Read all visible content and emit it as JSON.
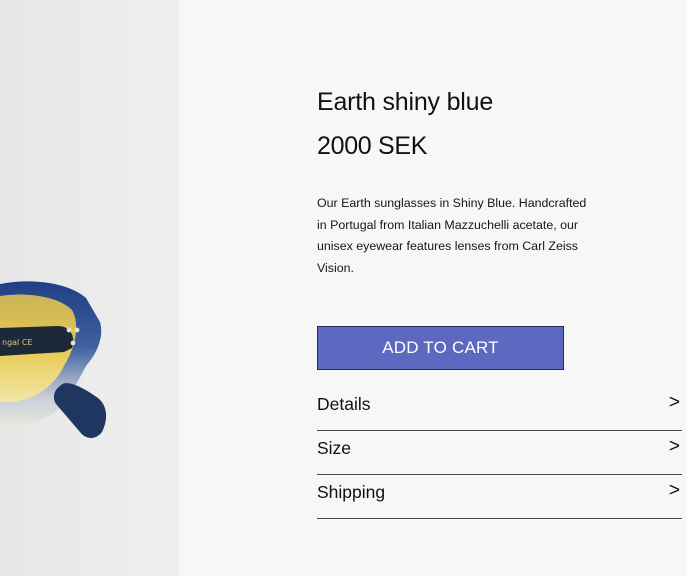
{
  "product": {
    "title": "Earth shiny blue",
    "price": "2000 SEK",
    "description": "Our Earth sunglasses in Shiny Blue. Handcrafted in Portugal from Italian Mazzuchelli acetate, our unisex eyewear features lenses from Carl Zeiss Vision.",
    "image_temple_text": "ngal CE"
  },
  "actions": {
    "add_to_cart_label": "ADD TO CART"
  },
  "accordion": [
    {
      "label": "Details",
      "icon": ">"
    },
    {
      "label": "Size",
      "icon": ">"
    },
    {
      "label": "Shipping",
      "icon": ">"
    }
  ],
  "colors": {
    "background": "#f7f7f7",
    "image_background": "#ebebeb",
    "cart_button": "#5d68c1",
    "frame_blue": "#2c4a8c",
    "lens_yellow": "#e8c64e"
  }
}
